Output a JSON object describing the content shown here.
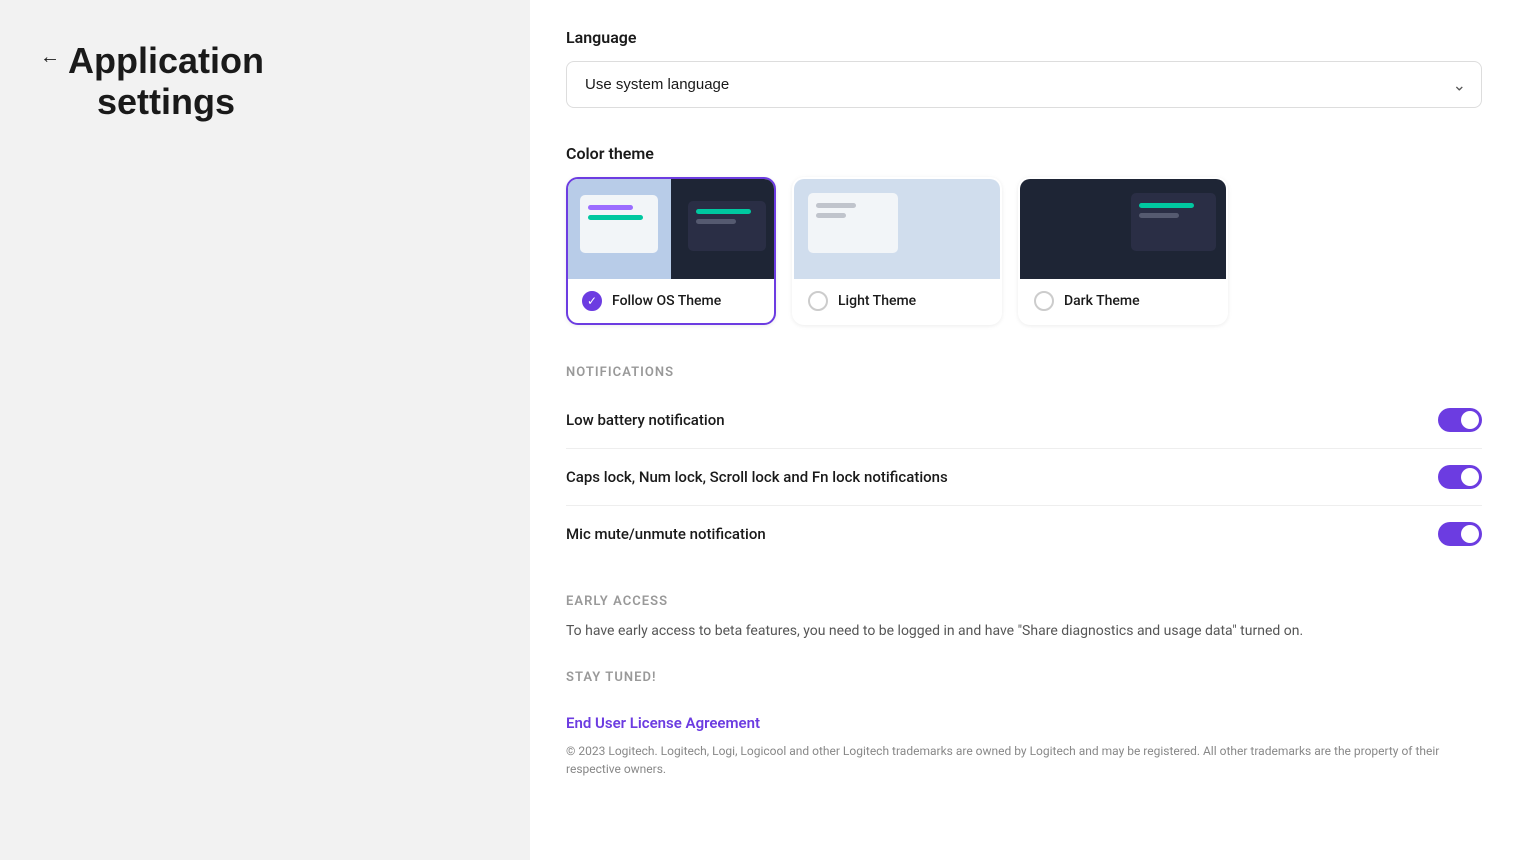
{
  "window": {
    "minimize_label": "—",
    "close_label": "✕"
  },
  "left_panel": {
    "back_arrow": "←",
    "title_line1": "Application",
    "title_line2": "settings"
  },
  "right_panel": {
    "language": {
      "label": "Language",
      "selected": "Use system language",
      "chevron": "∨"
    },
    "color_theme": {
      "label": "Color theme",
      "themes": [
        {
          "id": "follow-os",
          "name": "Follow OS Theme",
          "selected": true
        },
        {
          "id": "light",
          "name": "Light Theme",
          "selected": false
        },
        {
          "id": "dark",
          "name": "Dark Theme",
          "selected": false
        }
      ]
    },
    "notifications": {
      "section_label": "Notifications",
      "items": [
        {
          "label": "Low battery notification",
          "enabled": true
        },
        {
          "label": "Caps lock, Num lock, Scroll lock and Fn lock notifications",
          "enabled": true
        },
        {
          "label": "Mic mute/unmute notification",
          "enabled": true
        }
      ]
    },
    "early_access": {
      "section_label": "Early Access",
      "description": "To have early access to beta features, you need to be logged in and have \"Share diagnostics and usage data\" turned on."
    },
    "stay_tuned": {
      "section_label": "Stay Tuned!"
    },
    "eula": {
      "link_text": "End User License Agreement",
      "copyright": "© 2023 Logitech. Logitech, Logi, Logicool and other Logitech trademarks are owned by Logitech and may be registered. All other trademarks are the property of their respective owners."
    }
  }
}
